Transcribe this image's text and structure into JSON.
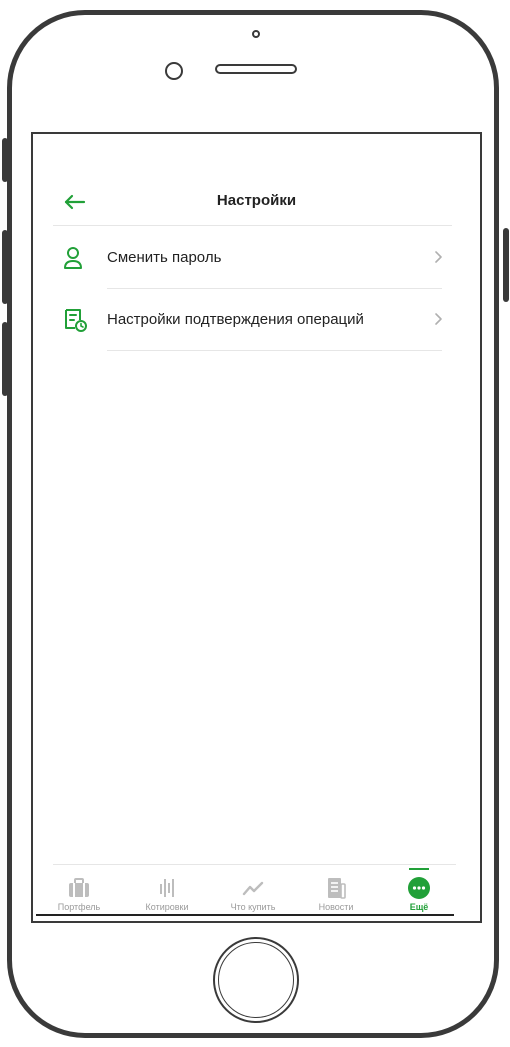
{
  "header": {
    "title": "Настройки",
    "back_icon": "arrow-left-icon"
  },
  "settings": {
    "items": [
      {
        "label": "Сменить пароль",
        "icon": "user-icon"
      },
      {
        "label": "Настройки подтверждения операций",
        "icon": "document-clock-icon"
      }
    ]
  },
  "tabbar": {
    "tabs": [
      {
        "label": "Портфель",
        "icon": "briefcase-icon",
        "active": false
      },
      {
        "label": "Котировки",
        "icon": "bars-icon",
        "active": false
      },
      {
        "label": "Что купить",
        "icon": "trend-icon",
        "active": false
      },
      {
        "label": "Новости",
        "icon": "newspaper-icon",
        "active": false
      },
      {
        "label": "Ещё",
        "icon": "more-dots-icon",
        "active": true
      }
    ]
  },
  "colors": {
    "accent": "#21a038",
    "text": "#222222",
    "muted": "#9a9a9a",
    "divider": "#e6e6e6",
    "frame": "#3a3a3a"
  }
}
